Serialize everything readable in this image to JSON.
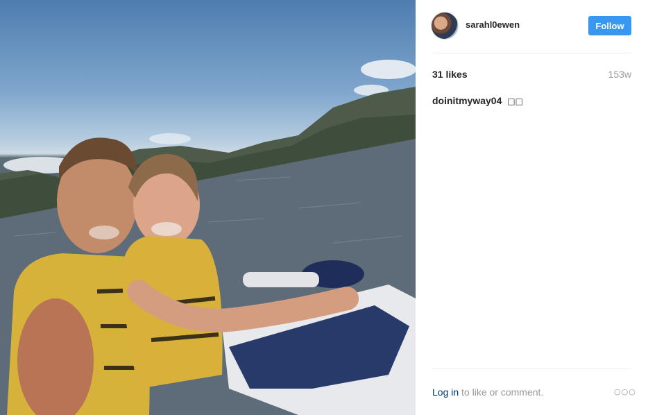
{
  "post": {
    "photo_alt": "Couple selfie on a jet ski on a lake"
  },
  "header": {
    "username": "sarahl0ewen",
    "follow_label": "Follow"
  },
  "stats": {
    "likes": "31 likes",
    "time_ago": "153w"
  },
  "comments": [
    {
      "author": "doinitmyway04",
      "text": "□□"
    }
  ],
  "footer": {
    "login_label": "Log in",
    "login_suffix": " to like or comment.",
    "more_icon": "ellipsis-icon",
    "more_glyph": "○○○"
  },
  "colors": {
    "follow_button": "#3897f0",
    "link": "#003569",
    "muted": "#999999"
  }
}
